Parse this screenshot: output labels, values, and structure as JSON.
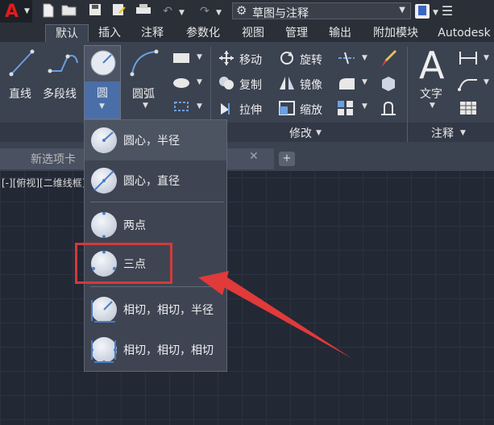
{
  "qat": {
    "workspace_label": "草图与注释"
  },
  "tabs": [
    "默认",
    "插入",
    "注释",
    "参数化",
    "视图",
    "管理",
    "输出",
    "附加模块",
    "Autodesk"
  ],
  "draw": {
    "line": "直线",
    "polyline": "多段线",
    "circle": "圆",
    "arc": "圆弧"
  },
  "modify": {
    "move": "移动",
    "rotate": "旋转",
    "copy": "复制",
    "mirror": "镜像",
    "stretch": "拉伸",
    "scale": "缩放",
    "panel_label": "修改"
  },
  "annotation": {
    "text": "文字",
    "panel_label": "注释"
  },
  "doc_tabs": {
    "new_tab": "新选项卡"
  },
  "viewport_label": "[-][俯视][二维线框]",
  "circle_menu": [
    {
      "label": "圆心，半径"
    },
    {
      "label": "圆心，直径"
    },
    {
      "label": "两点"
    },
    {
      "label": "三点"
    },
    {
      "label": "相切，相切，半径"
    },
    {
      "label": "相切，相切，相切"
    }
  ],
  "colors": {
    "highlight_box": "#d33a3a",
    "arrow": "#e03a3a",
    "app_logo": "#e01c1c"
  },
  "icons": [
    "app-logo-icon",
    "new-file-icon",
    "open-folder-icon",
    "save-icon",
    "save-as-icon",
    "print-icon",
    "undo-icon",
    "redo-icon",
    "gear-icon"
  ]
}
